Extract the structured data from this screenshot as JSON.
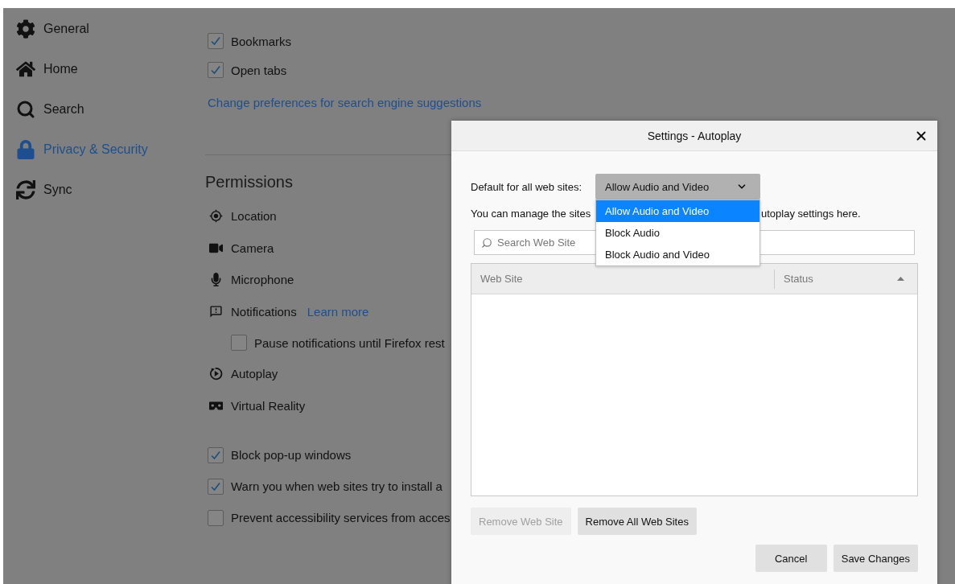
{
  "sidebar": {
    "items": [
      {
        "label": "General",
        "selected": false
      },
      {
        "label": "Home",
        "selected": false
      },
      {
        "label": "Search",
        "selected": false
      },
      {
        "label": "Privacy & Security",
        "selected": true
      },
      {
        "label": "Sync",
        "selected": false
      }
    ]
  },
  "suggestions": {
    "checkboxes": [
      {
        "label": "Bookmarks",
        "checked": true
      },
      {
        "label": "Open tabs",
        "checked": true
      }
    ],
    "link": "Change preferences for search engine suggestions"
  },
  "permissions": {
    "heading": "Permissions",
    "items": [
      {
        "kind": "permission",
        "label": "Location"
      },
      {
        "kind": "permission",
        "label": "Camera"
      },
      {
        "kind": "permission",
        "label": "Microphone"
      },
      {
        "kind": "permission",
        "label": "Notifications",
        "link": "Learn more"
      },
      {
        "kind": "checkbox",
        "label": "Pause notifications until Firefox rest",
        "checked": false
      },
      {
        "kind": "permission",
        "label": "Autoplay"
      },
      {
        "kind": "permission",
        "label": "Virtual Reality"
      }
    ]
  },
  "options": [
    {
      "label": "Block pop-up windows",
      "checked": true
    },
    {
      "label": "Warn you when web sites try to install a",
      "checked": true
    },
    {
      "label": "Prevent accessibility services from acces",
      "checked": false
    }
  ],
  "dialog": {
    "title": "Settings - Autoplay",
    "default_label": "Default for all web sites:",
    "select": {
      "value": "Allow Audio and Video",
      "expanded": true,
      "options": [
        {
          "label": "Allow Audio and Video",
          "selected": true
        },
        {
          "label": "Block Audio",
          "selected": false
        },
        {
          "label": "Block Audio and Video",
          "selected": false
        }
      ]
    },
    "manage_text_start": "You can manage the sites",
    "manage_text_end": "utoplay settings here.",
    "search": {
      "placeholder": "Search Web Site"
    },
    "table": {
      "columns": [
        "Web Site",
        "Status"
      ]
    },
    "list_buttons": [
      {
        "label": "Remove Web Site",
        "disabled": true
      },
      {
        "label": "Remove All Web Sites",
        "disabled": false
      }
    ],
    "footer_buttons": [
      {
        "label": "Cancel"
      },
      {
        "label": "Save Changes"
      }
    ]
  }
}
